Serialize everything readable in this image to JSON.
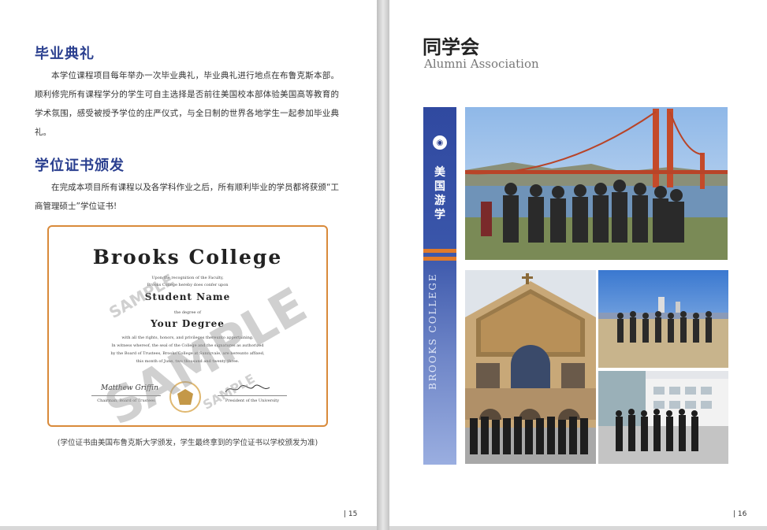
{
  "left_page": {
    "section1": {
      "heading": "毕业典礼",
      "body": "本学位课程项目每年举办一次毕业典礼，毕业典礼进行地点在布鲁克斯本部。顺利修完所有课程学分的学生可自主选择是否前往美国校本部体验美国高等教育的学术氛围，感受被授予学位的庄严仪式，与全日制的世界各地学生一起参加毕业典礼。"
    },
    "section2": {
      "heading": "学位证书颁发",
      "body": "在完成本项目所有课程以及各学科作业之后，所有顺利毕业的学员都将获颁“工商管理硕士”学位证书!"
    },
    "certificate": {
      "title": "Brooks College",
      "line1": "Upon the recognition of the Faculty,",
      "line2": "Brooks College hereby does confer upon",
      "student_name": "Student Name",
      "line3": "the degree of",
      "degree": "Your Degree",
      "line4": "with all the rights, honors, and privileges thereunto appertaining.",
      "line5": "In witness whereof, the seal of the College and the signatures as authorized",
      "line6": "by the Board of Trustees, Brooks College at Sunnyvale, are hereunto affixed,",
      "line7": "this month of June, two thousand and twenty three.",
      "signature_left": "Matthew Griffin",
      "signature_left_title": "Chairman, Board of Trustees",
      "signature_right_title": "President of the University",
      "watermark_large": "SAMPLE",
      "watermark_small": "SAMPLE"
    },
    "caption": "(学位证书由美国布鲁克斯大学颁发，学生最终拿到的学位证书以学校颁发为准)",
    "page_number": "| 15"
  },
  "right_page": {
    "title_cn": "同学会",
    "title_en": "Alumni Association",
    "band_label_cn": "美国游学",
    "band_label_en": "BROOKS COLLEGE",
    "page_number": "| 16"
  },
  "colors": {
    "heading_blue": "#2a3f8f",
    "accent_orange": "#e07a2a",
    "band_blue": "#3049a0"
  }
}
